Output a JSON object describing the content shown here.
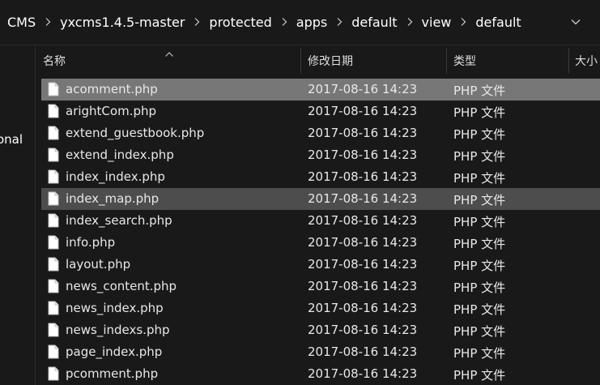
{
  "breadcrumb": [
    "CMS",
    "yxcms1.4.5-master",
    "protected",
    "apps",
    "default",
    "view",
    "default"
  ],
  "nav_pane": {
    "peek_text": "onal"
  },
  "columns": {
    "name": "名称",
    "modified": "修改日期",
    "type": "类型",
    "size": "大小"
  },
  "files": [
    {
      "name": "acomment.php",
      "modified": "2017-08-16 14:23",
      "type": "PHP 文件",
      "state": "selected"
    },
    {
      "name": "arightCom.php",
      "modified": "2017-08-16 14:23",
      "type": "PHP 文件",
      "state": ""
    },
    {
      "name": "extend_guestbook.php",
      "modified": "2017-08-16 14:23",
      "type": "PHP 文件",
      "state": ""
    },
    {
      "name": "extend_index.php",
      "modified": "2017-08-16 14:23",
      "type": "PHP 文件",
      "state": ""
    },
    {
      "name": "index_index.php",
      "modified": "2017-08-16 14:23",
      "type": "PHP 文件",
      "state": ""
    },
    {
      "name": "index_map.php",
      "modified": "2017-08-16 14:23",
      "type": "PHP 文件",
      "state": "hover"
    },
    {
      "name": "index_search.php",
      "modified": "2017-08-16 14:23",
      "type": "PHP 文件",
      "state": ""
    },
    {
      "name": "info.php",
      "modified": "2017-08-16 14:23",
      "type": "PHP 文件",
      "state": ""
    },
    {
      "name": "layout.php",
      "modified": "2017-08-16 14:23",
      "type": "PHP 文件",
      "state": ""
    },
    {
      "name": "news_content.php",
      "modified": "2017-08-16 14:23",
      "type": "PHP 文件",
      "state": ""
    },
    {
      "name": "news_index.php",
      "modified": "2017-08-16 14:23",
      "type": "PHP 文件",
      "state": ""
    },
    {
      "name": "news_indexs.php",
      "modified": "2017-08-16 14:23",
      "type": "PHP 文件",
      "state": ""
    },
    {
      "name": "page_index.php",
      "modified": "2017-08-16 14:23",
      "type": "PHP 文件",
      "state": ""
    },
    {
      "name": "pcomment.php",
      "modified": "2017-08-16 14:23",
      "type": "PHP 文件",
      "state": ""
    }
  ],
  "icons": {
    "file": "document-icon",
    "sort": "chevron-up-icon",
    "dropdown": "chevron-down-icon",
    "separator": "chevron-right-icon"
  },
  "colors": {
    "background": "#191919",
    "selected_row": "#777777",
    "hover_row": "#4d4d4d",
    "text": "#ffffff"
  }
}
